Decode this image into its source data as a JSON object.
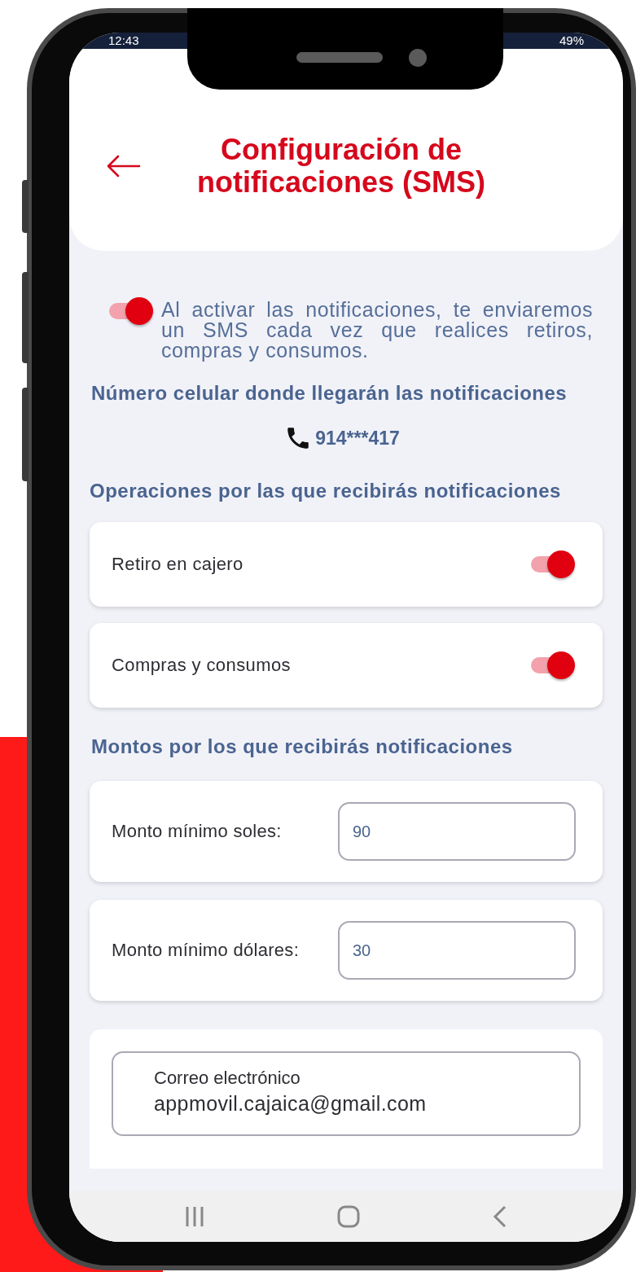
{
  "status_bar": {
    "time": "12:43",
    "battery": "49%"
  },
  "header": {
    "title": "Configuración de notificaciones (SMS)"
  },
  "intro": {
    "on": true,
    "text": "Al activar las notificaciones, te enviaremos un SMS cada vez que realices retiros, compras y consumos."
  },
  "phone_section": {
    "heading": "Número celular donde llegarán las notificaciones",
    "number": "914***417"
  },
  "operations": {
    "heading": "Operaciones por las que recibirás notificaciones",
    "items": [
      {
        "label": "Retiro en cajero",
        "on": true
      },
      {
        "label": "Compras y consumos",
        "on": true
      }
    ]
  },
  "amounts": {
    "heading": "Montos por los que recibirás notificaciones",
    "fields": [
      {
        "label": "Monto mínimo soles:",
        "value": "90"
      },
      {
        "label": "Monto mínimo dólares:",
        "value": "30"
      }
    ]
  },
  "email_field": {
    "label": "Correo electrónico",
    "value": "appmovil.cajaica@gmail.com"
  }
}
